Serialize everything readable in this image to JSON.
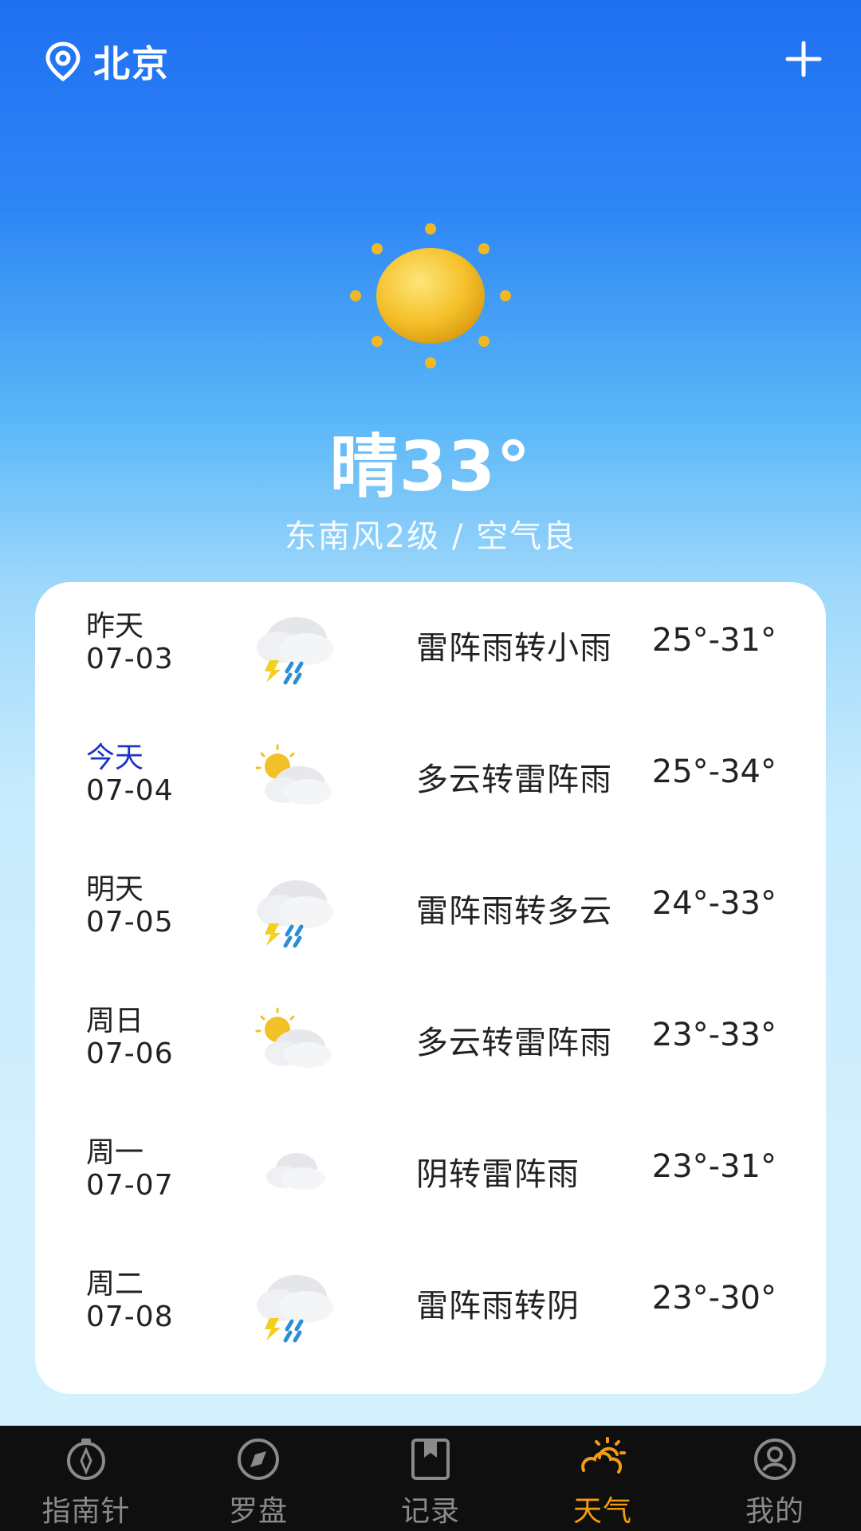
{
  "header": {
    "location": "北京",
    "location_icon": "location-pin-icon",
    "add_icon": "plus-icon"
  },
  "current": {
    "condition_temp": "晴33°",
    "details": "东南风2级 / 空气良",
    "icon": "sun-icon"
  },
  "forecast": [
    {
      "day": "昨天",
      "date": "07-03",
      "icon": "thunderstorm-rain-icon",
      "desc": "雷阵雨转小雨",
      "temp": "25°-31°"
    },
    {
      "day": "今天",
      "date": "07-04",
      "icon": "partly-cloudy-icon",
      "desc": "多云转雷阵雨",
      "temp": "25°-34°"
    },
    {
      "day": "明天",
      "date": "07-05",
      "icon": "thunderstorm-rain-icon",
      "desc": "雷阵雨转多云",
      "temp": "24°-33°"
    },
    {
      "day": "周日",
      "date": "07-06",
      "icon": "partly-cloudy-icon",
      "desc": "多云转雷阵雨",
      "temp": "23°-33°"
    },
    {
      "day": "周一",
      "date": "07-07",
      "icon": "cloud-icon",
      "desc": "阴转雷阵雨",
      "temp": "23°-31°"
    },
    {
      "day": "周二",
      "date": "07-08",
      "icon": "thunderstorm-rain-icon",
      "desc": "雷阵雨转阴",
      "temp": "23°-30°"
    }
  ],
  "nav": [
    {
      "label": "指南针",
      "icon": "compass-needle-icon",
      "active": false
    },
    {
      "label": "罗盘",
      "icon": "compass-icon",
      "active": false
    },
    {
      "label": "记录",
      "icon": "bookmark-icon",
      "active": false
    },
    {
      "label": "天气",
      "icon": "weather-icon",
      "active": true
    },
    {
      "label": "我的",
      "icon": "profile-icon",
      "active": false
    }
  ],
  "colors": {
    "today": "#1d33c6",
    "nav_active": "#f39c12",
    "nav_inactive": "#8a8a8a"
  }
}
